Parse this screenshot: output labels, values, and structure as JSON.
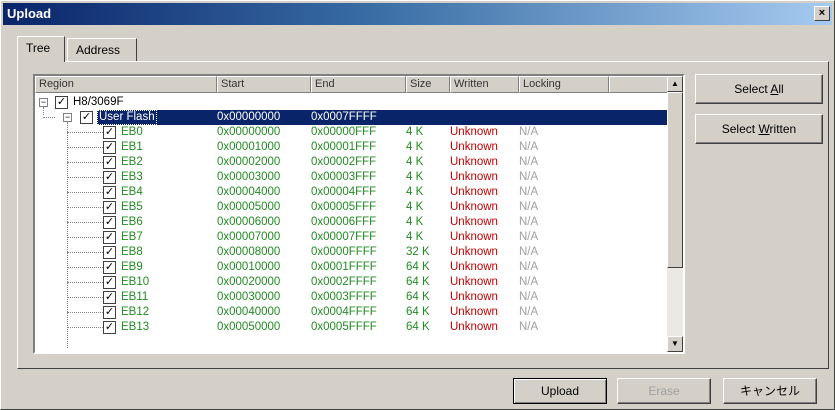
{
  "window": {
    "title": "Upload",
    "close_glyph": "×"
  },
  "tabs": [
    {
      "label": "Tree",
      "active": true
    },
    {
      "label": "Address",
      "active": false
    }
  ],
  "columns": [
    "Region",
    "Start",
    "End",
    "Size",
    "Written",
    "Locking"
  ],
  "tree": {
    "root": {
      "name": "H8/3069F",
      "expander": "−",
      "checked": true
    },
    "flash": {
      "name": "User Flash",
      "start": "0x00000000",
      "end": "0x0007FFFF",
      "expander": "−",
      "checked": true,
      "selected": true
    },
    "blocks": [
      {
        "name": "EB0",
        "start": "0x00000000",
        "end": "0x00000FFF",
        "size": "4 K",
        "written": "Unknown",
        "locking": "N/A"
      },
      {
        "name": "EB1",
        "start": "0x00001000",
        "end": "0x00001FFF",
        "size": "4 K",
        "written": "Unknown",
        "locking": "N/A"
      },
      {
        "name": "EB2",
        "start": "0x00002000",
        "end": "0x00002FFF",
        "size": "4 K",
        "written": "Unknown",
        "locking": "N/A"
      },
      {
        "name": "EB3",
        "start": "0x00003000",
        "end": "0x00003FFF",
        "size": "4 K",
        "written": "Unknown",
        "locking": "N/A"
      },
      {
        "name": "EB4",
        "start": "0x00004000",
        "end": "0x00004FFF",
        "size": "4 K",
        "written": "Unknown",
        "locking": "N/A"
      },
      {
        "name": "EB5",
        "start": "0x00005000",
        "end": "0x00005FFF",
        "size": "4 K",
        "written": "Unknown",
        "locking": "N/A"
      },
      {
        "name": "EB6",
        "start": "0x00006000",
        "end": "0x00006FFF",
        "size": "4 K",
        "written": "Unknown",
        "locking": "N/A"
      },
      {
        "name": "EB7",
        "start": "0x00007000",
        "end": "0x00007FFF",
        "size": "4 K",
        "written": "Unknown",
        "locking": "N/A"
      },
      {
        "name": "EB8",
        "start": "0x00008000",
        "end": "0x0000FFFF",
        "size": "32 K",
        "written": "Unknown",
        "locking": "N/A"
      },
      {
        "name": "EB9",
        "start": "0x00010000",
        "end": "0x0001FFFF",
        "size": "64 K",
        "written": "Unknown",
        "locking": "N/A"
      },
      {
        "name": "EB10",
        "start": "0x00020000",
        "end": "0x0002FFFF",
        "size": "64 K",
        "written": "Unknown",
        "locking": "N/A"
      },
      {
        "name": "EB11",
        "start": "0x00030000",
        "end": "0x0003FFFF",
        "size": "64 K",
        "written": "Unknown",
        "locking": "N/A"
      },
      {
        "name": "EB12",
        "start": "0x00040000",
        "end": "0x0004FFFF",
        "size": "64 K",
        "written": "Unknown",
        "locking": "N/A"
      },
      {
        "name": "EB13",
        "start": "0x00050000",
        "end": "0x0005FFFF",
        "size": "64 K",
        "written": "Unknown",
        "locking": "N/A"
      }
    ]
  },
  "scrollbar": {
    "up_glyph": "▲",
    "down_glyph": "▼"
  },
  "side_buttons": {
    "select_all": {
      "pre": "Select ",
      "accel": "A",
      "post": "ll"
    },
    "select_written": {
      "pre": "Select ",
      "accel": "W",
      "post": "ritten"
    }
  },
  "footer_buttons": {
    "upload": "Upload",
    "erase": "Erase",
    "cancel": "キャンセル"
  },
  "colors": {
    "selection": "#0a246a",
    "block_text": "#228b22",
    "written_text": "#c00000",
    "locking_text": "#a0a0a0"
  }
}
